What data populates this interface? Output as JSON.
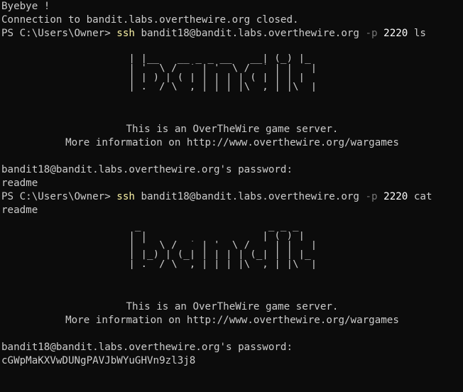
{
  "terminal": {
    "line_byebye": "Byebye !",
    "line_closed": "Connection to bandit.labs.overthewire.org closed.",
    "session1": {
      "prompt": "PS C:\\Users\\Owner> ",
      "cmd": "ssh",
      "host": " bandit18@bandit.labs.overthewire.org ",
      "flag": "-p",
      "port": " 2220",
      "args": " ls",
      "args_cont": "",
      "banner_ascii": [
        "                      _                     _ _ _",
        "                     | |__   __ _ _ __   __| (_) |_",
        "                     | '_ \\ / _` | '_ \\ / _` | | __|",
        "                     | |_) | (_| | | | | (_| | | |_",
        "                     |_.__/ \\__,_|_| |_|\\__,_|_|\\__|"
      ],
      "banner_line1": "This is an OverTheWire game server.",
      "banner_line2": "More information on http://www.overthewire.org/wargames",
      "password_prompt": "bandit18@bandit.labs.overthewire.org's password:",
      "output": "readme"
    },
    "session2": {
      "prompt": "PS C:\\Users\\Owner> ",
      "cmd": "ssh",
      "host": " bandit18@bandit.labs.overthewire.org ",
      "flag": "-p",
      "port": " 2220",
      "args": " cat",
      "args_cont": "readme",
      "banner_ascii": [
        "                      _                     _ _ _",
        "                     | |__   __ _ _ __   __| (_) |_",
        "                     | '_ \\ / _` | '_ \\ / _` | | __|",
        "                     | |_) | (_| | | | | (_| | | |_",
        "                     |_.__/ \\__,_|_| |_|\\__,_|_|\\__|"
      ],
      "banner_line1": "This is an OverTheWire game server.",
      "banner_line2": "More information on http://www.overthewire.org/wargames",
      "password_prompt": "bandit18@bandit.labs.overthewire.org's password:",
      "output": "cGWpMaKXVwDUNgPAVJbWYuGHVn9zl3j8"
    },
    "colors": {
      "background": "#0c0c0c",
      "text": "#cccccc",
      "command": "#f9f1a5",
      "flag": "#767676",
      "number": "#ffffff"
    }
  }
}
